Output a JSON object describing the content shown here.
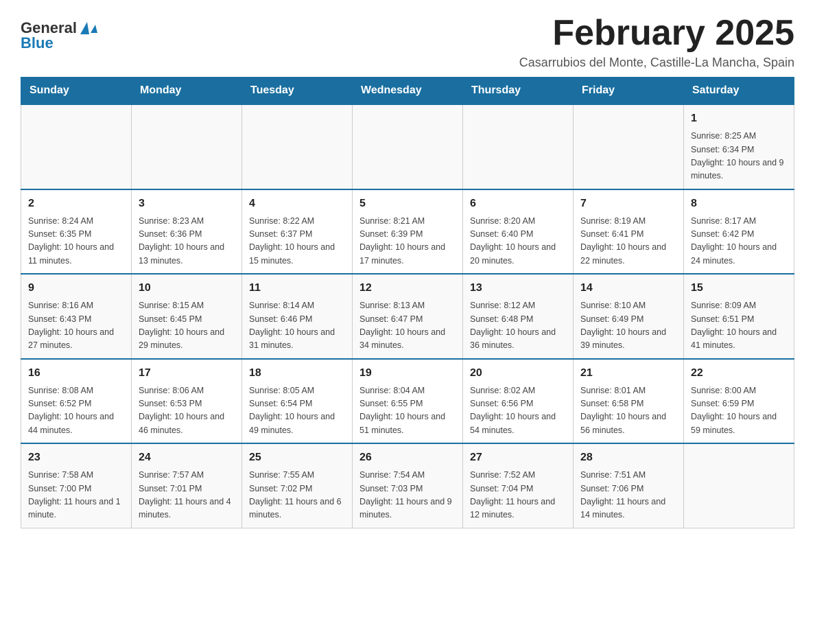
{
  "header": {
    "logo_general": "General",
    "logo_blue": "Blue",
    "title": "February 2025",
    "subtitle": "Casarrubios del Monte, Castille-La Mancha, Spain"
  },
  "weekdays": [
    "Sunday",
    "Monday",
    "Tuesday",
    "Wednesday",
    "Thursday",
    "Friday",
    "Saturday"
  ],
  "rows": [
    {
      "cells": [
        {
          "day": "",
          "info": ""
        },
        {
          "day": "",
          "info": ""
        },
        {
          "day": "",
          "info": ""
        },
        {
          "day": "",
          "info": ""
        },
        {
          "day": "",
          "info": ""
        },
        {
          "day": "",
          "info": ""
        },
        {
          "day": "1",
          "info": "Sunrise: 8:25 AM\nSunset: 6:34 PM\nDaylight: 10 hours and 9 minutes."
        }
      ]
    },
    {
      "cells": [
        {
          "day": "2",
          "info": "Sunrise: 8:24 AM\nSunset: 6:35 PM\nDaylight: 10 hours and 11 minutes."
        },
        {
          "day": "3",
          "info": "Sunrise: 8:23 AM\nSunset: 6:36 PM\nDaylight: 10 hours and 13 minutes."
        },
        {
          "day": "4",
          "info": "Sunrise: 8:22 AM\nSunset: 6:37 PM\nDaylight: 10 hours and 15 minutes."
        },
        {
          "day": "5",
          "info": "Sunrise: 8:21 AM\nSunset: 6:39 PM\nDaylight: 10 hours and 17 minutes."
        },
        {
          "day": "6",
          "info": "Sunrise: 8:20 AM\nSunset: 6:40 PM\nDaylight: 10 hours and 20 minutes."
        },
        {
          "day": "7",
          "info": "Sunrise: 8:19 AM\nSunset: 6:41 PM\nDaylight: 10 hours and 22 minutes."
        },
        {
          "day": "8",
          "info": "Sunrise: 8:17 AM\nSunset: 6:42 PM\nDaylight: 10 hours and 24 minutes."
        }
      ]
    },
    {
      "cells": [
        {
          "day": "9",
          "info": "Sunrise: 8:16 AM\nSunset: 6:43 PM\nDaylight: 10 hours and 27 minutes."
        },
        {
          "day": "10",
          "info": "Sunrise: 8:15 AM\nSunset: 6:45 PM\nDaylight: 10 hours and 29 minutes."
        },
        {
          "day": "11",
          "info": "Sunrise: 8:14 AM\nSunset: 6:46 PM\nDaylight: 10 hours and 31 minutes."
        },
        {
          "day": "12",
          "info": "Sunrise: 8:13 AM\nSunset: 6:47 PM\nDaylight: 10 hours and 34 minutes."
        },
        {
          "day": "13",
          "info": "Sunrise: 8:12 AM\nSunset: 6:48 PM\nDaylight: 10 hours and 36 minutes."
        },
        {
          "day": "14",
          "info": "Sunrise: 8:10 AM\nSunset: 6:49 PM\nDaylight: 10 hours and 39 minutes."
        },
        {
          "day": "15",
          "info": "Sunrise: 8:09 AM\nSunset: 6:51 PM\nDaylight: 10 hours and 41 minutes."
        }
      ]
    },
    {
      "cells": [
        {
          "day": "16",
          "info": "Sunrise: 8:08 AM\nSunset: 6:52 PM\nDaylight: 10 hours and 44 minutes."
        },
        {
          "day": "17",
          "info": "Sunrise: 8:06 AM\nSunset: 6:53 PM\nDaylight: 10 hours and 46 minutes."
        },
        {
          "day": "18",
          "info": "Sunrise: 8:05 AM\nSunset: 6:54 PM\nDaylight: 10 hours and 49 minutes."
        },
        {
          "day": "19",
          "info": "Sunrise: 8:04 AM\nSunset: 6:55 PM\nDaylight: 10 hours and 51 minutes."
        },
        {
          "day": "20",
          "info": "Sunrise: 8:02 AM\nSunset: 6:56 PM\nDaylight: 10 hours and 54 minutes."
        },
        {
          "day": "21",
          "info": "Sunrise: 8:01 AM\nSunset: 6:58 PM\nDaylight: 10 hours and 56 minutes."
        },
        {
          "day": "22",
          "info": "Sunrise: 8:00 AM\nSunset: 6:59 PM\nDaylight: 10 hours and 59 minutes."
        }
      ]
    },
    {
      "cells": [
        {
          "day": "23",
          "info": "Sunrise: 7:58 AM\nSunset: 7:00 PM\nDaylight: 11 hours and 1 minute."
        },
        {
          "day": "24",
          "info": "Sunrise: 7:57 AM\nSunset: 7:01 PM\nDaylight: 11 hours and 4 minutes."
        },
        {
          "day": "25",
          "info": "Sunrise: 7:55 AM\nSunset: 7:02 PM\nDaylight: 11 hours and 6 minutes."
        },
        {
          "day": "26",
          "info": "Sunrise: 7:54 AM\nSunset: 7:03 PM\nDaylight: 11 hours and 9 minutes."
        },
        {
          "day": "27",
          "info": "Sunrise: 7:52 AM\nSunset: 7:04 PM\nDaylight: 11 hours and 12 minutes."
        },
        {
          "day": "28",
          "info": "Sunrise: 7:51 AM\nSunset: 7:06 PM\nDaylight: 11 hours and 14 minutes."
        },
        {
          "day": "",
          "info": ""
        }
      ]
    }
  ]
}
